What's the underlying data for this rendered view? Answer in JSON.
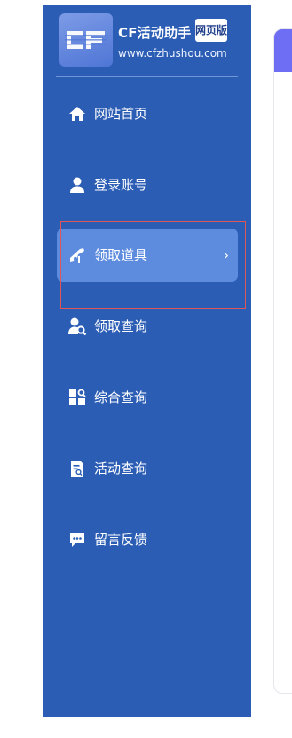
{
  "brand": {
    "title": "CF活动助手",
    "badge": "网页版",
    "url": "www.cfzhushou.com",
    "logo_text": "CF"
  },
  "nav": {
    "items": [
      {
        "label": "网站首页",
        "icon": "home-icon"
      },
      {
        "label": "登录账号",
        "icon": "user-icon"
      },
      {
        "label": "领取道具",
        "icon": "gun-icon",
        "active": true,
        "chevron": "›"
      },
      {
        "label": "领取查询",
        "icon": "user-search-icon"
      },
      {
        "label": "综合查询",
        "icon": "grid-search-icon"
      },
      {
        "label": "活动查询",
        "icon": "document-search-icon"
      },
      {
        "label": "留言反馈",
        "icon": "chat-icon"
      }
    ]
  },
  "colors": {
    "sidebar": "#2b5db5",
    "active_item": "#5d8cdf",
    "accent": "#6e6ef5"
  }
}
